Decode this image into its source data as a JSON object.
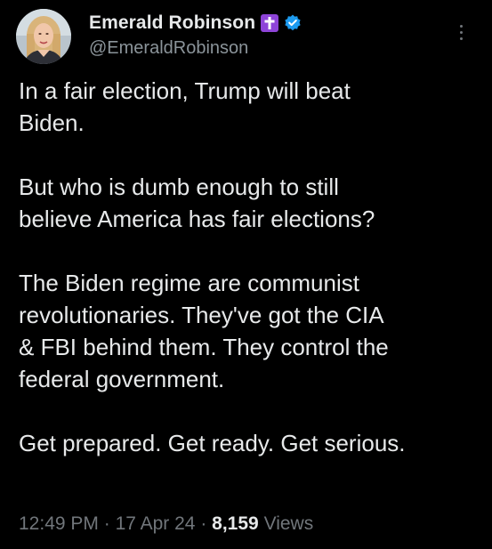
{
  "author": {
    "display_name": "Emerald Robinson",
    "handle": "@EmeraldRobinson",
    "badge_icon": "cross-icon",
    "badge_color": "#8e44d8",
    "verified_icon": "verified-check-icon",
    "verified_color": "#1d9bf0"
  },
  "tweet": {
    "paragraphs": [
      "In a fair election, Trump will beat\nBiden.",
      "But who is dumb enough to still\nbelieve America has fair elections?",
      "The Biden regime are communist\nrevolutionaries. They've got the CIA\n& FBI behind them. They control the\nfederal government.",
      "Get prepared. Get ready. Get serious."
    ]
  },
  "meta": {
    "time": "12:49 PM",
    "separator": "·",
    "date": "17 Apr 24",
    "views_count": "8,159",
    "views_label": "Views"
  },
  "menu": {
    "icon": "more-options-icon"
  },
  "colors": {
    "background": "#000000",
    "text_primary": "#e7e9ea",
    "text_secondary": "#71767b"
  }
}
